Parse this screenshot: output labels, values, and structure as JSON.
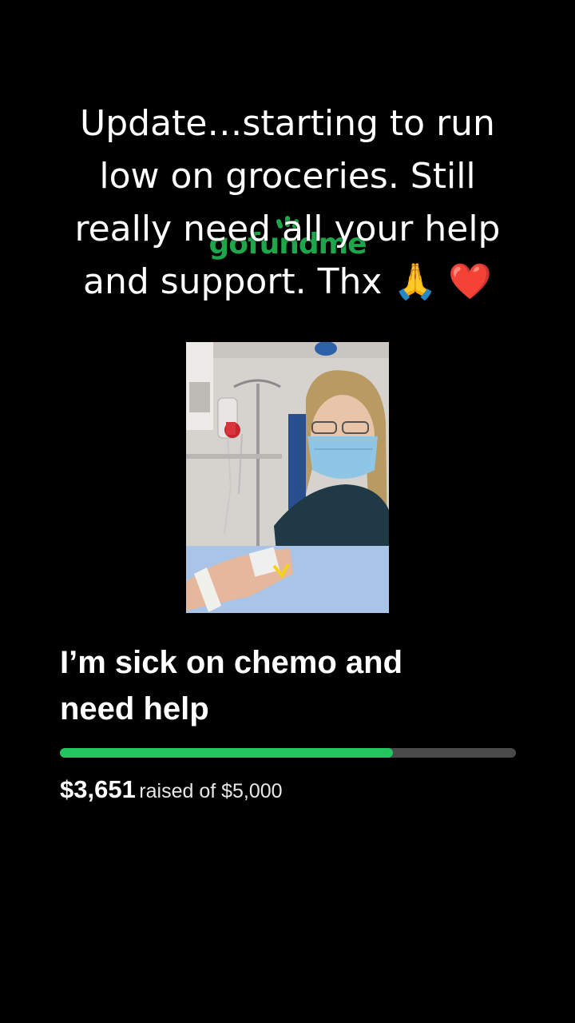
{
  "overlay_caption": "Update…starting to run\nlow on groceries. Still\nreally need all your help\nand support. Thx 🙏 ❤️",
  "watermark_logo": "gofundme",
  "photo": {
    "alt": "woman wearing face mask receiving IV chemo treatment in hospital",
    "icon": "photo-image"
  },
  "campaign": {
    "title": "I’m sick on chemo and\nneed help",
    "raised_amount": "$3,651",
    "raised_of_text": "raised of $5,000",
    "raised_value": 3651,
    "goal_value": 5000,
    "progress_color": "#22c55e",
    "track_color": "#4a4a4a"
  }
}
